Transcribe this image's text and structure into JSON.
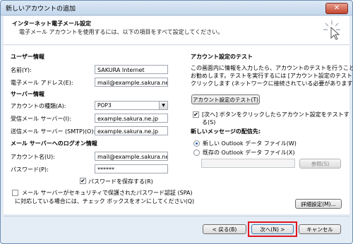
{
  "window": {
    "title": "新しいアカウントの追加",
    "close_symbol": "✕"
  },
  "header": {
    "title": "インターネット電子メール設定",
    "subtitle": "電子メール アカウントを使用するには、以下の項目をすべて設定してください。"
  },
  "user_info": {
    "section_title": "ユーザー情報",
    "name_label": "名前(Y):",
    "name_value": "SAKURA Internet",
    "email_label": "電子メール アドレス(E):",
    "email_value": "mail@example.sakura.ne.jp"
  },
  "server_info": {
    "section_title": "サーバー情報",
    "account_type_label": "アカウントの種類(A):",
    "account_type_value": "POP3",
    "incoming_label": "受信メール サーバー(I):",
    "incoming_value": "example.sakura.ne.jp",
    "outgoing_label": "送信メール サーバー (SMTP)(O):",
    "outgoing_value": "example.sakura.ne.jp"
  },
  "login_info": {
    "section_title": "メール サーバーへのログオン情報",
    "account_label": "アカウント名(U):",
    "account_value": "mail@example.sakura.ne.jp",
    "password_label": "パスワード(P):",
    "password_value": "******",
    "save_password_label": "パスワードを保存する(R)",
    "save_password_checked": true
  },
  "spa": {
    "line1": "メール サーバーがセキュリティで保護されたパスワード認証 (SPA)",
    "line2": "に対応している場合には、チェック ボックスをオンにしてください(Q)",
    "checked": false
  },
  "test": {
    "section_title": "アカウント設定のテスト",
    "desc_line1": "この画面内に情報を入力したら、アカウントのテストを行うことを",
    "desc_line2": "お勧めします。テストを実行するには [アカウント設定のテスト] を",
    "desc_line3": "クリックします (ネットワークに接続されている必要があります)。",
    "button_label": "アカウント設定のテスト(T)",
    "auto_test_line1": "[次へ] ボタンをクリックしたらアカウント設定をテストす",
    "auto_test_line2": "る(S)",
    "auto_test_checked": true
  },
  "delivery": {
    "section_title": "新しいメッセージの配信先:",
    "new_file_label": "新しい Outlook データ ファイル(W)",
    "existing_file_label": "既存の Outlook データ ファイル(X)",
    "selected": "new",
    "path_value": "",
    "browse_label": "参照(S)"
  },
  "advanced_button": "詳細設定(M)...",
  "footer": {
    "back_label": "< 戻る(B)",
    "next_label": "次へ(N) >",
    "cancel_label": "キャンセル"
  },
  "checkmark": "✔",
  "colors": {
    "highlight": "#e0161c",
    "window_bg": "#e4ecf5",
    "title_gradient_top": "#dce8f5"
  }
}
